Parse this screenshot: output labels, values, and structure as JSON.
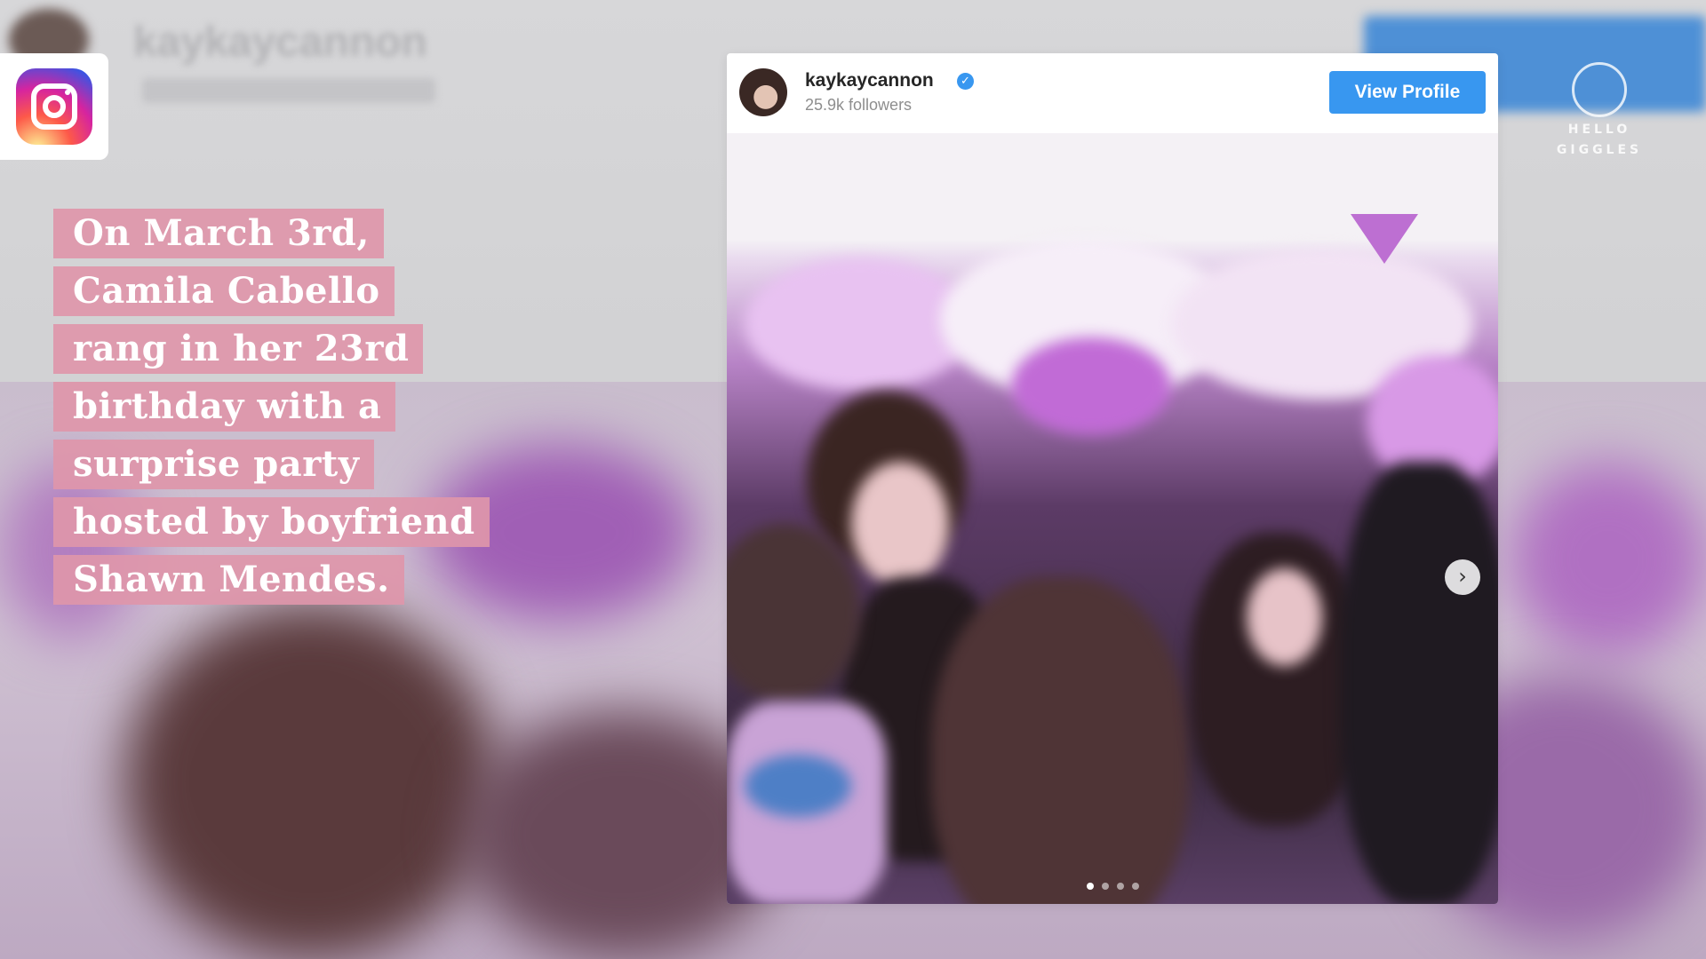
{
  "background": {
    "blurred_title": "kaykaycannon"
  },
  "badge": {
    "icon": "instagram-logo-icon"
  },
  "caption": {
    "lines": [
      "On March 3rd,",
      "Camila Cabello",
      "rang in her 23rd",
      "birthday with a",
      "surprise party",
      "hosted by boyfriend",
      "Shawn Mendes."
    ]
  },
  "post": {
    "username": "kaykaycannon",
    "verified_icon": "verified-badge-icon",
    "followers": "25.9k followers",
    "view_profile_label": "View Profile",
    "next_icon": "chevron-right-icon",
    "carousel": {
      "total": 4,
      "current": 1
    },
    "accent_color": "#3897f0"
  },
  "watermark": {
    "line1": "HELLO",
    "line2": "GIGGLES"
  }
}
